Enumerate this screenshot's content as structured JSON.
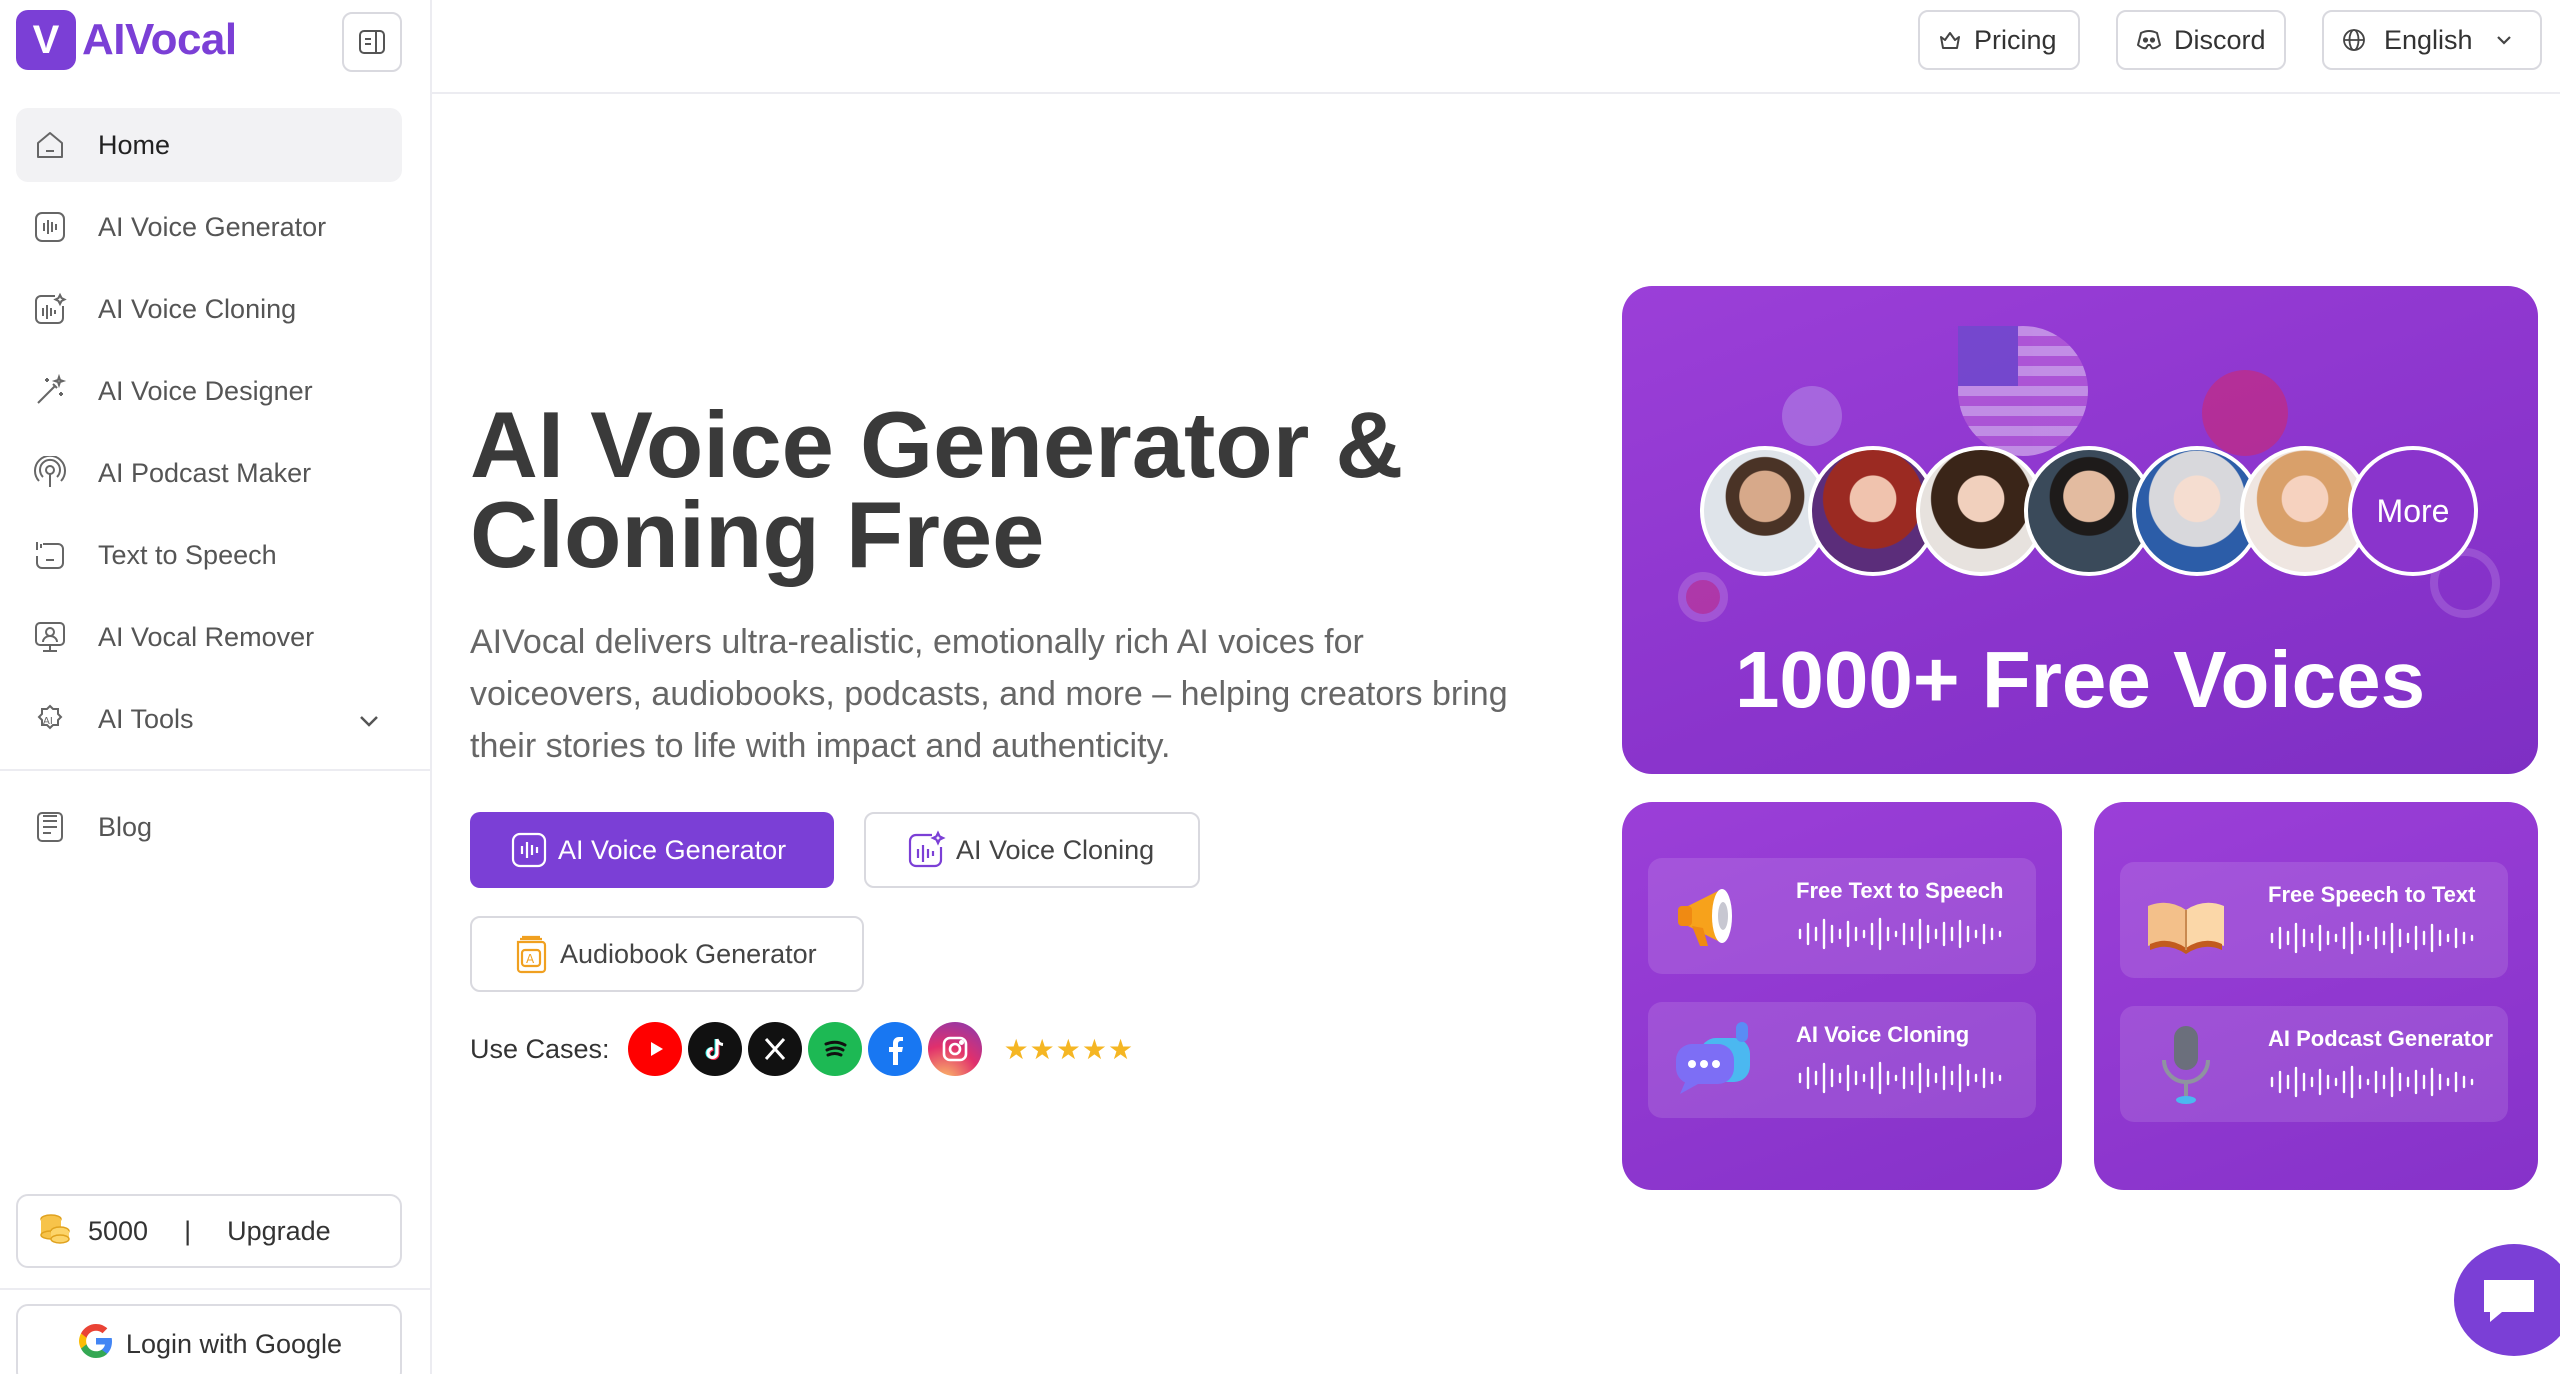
{
  "brand": {
    "mark": "V",
    "name": "AIVocal",
    "accent": "#7b3fd6"
  },
  "nav": {
    "items": [
      {
        "label": "Home",
        "icon": "home-icon",
        "active": true
      },
      {
        "label": "AI Voice Generator",
        "icon": "waveform-icon"
      },
      {
        "label": "AI Voice Cloning",
        "icon": "voice-clone-icon"
      },
      {
        "label": "AI Voice Designer",
        "icon": "magic-wand-icon"
      },
      {
        "label": "AI Podcast Maker",
        "icon": "podcast-icon"
      },
      {
        "label": "Text to Speech",
        "icon": "text-speech-icon"
      },
      {
        "label": "AI Vocal Remover",
        "icon": "vocal-remover-icon"
      },
      {
        "label": "AI Tools",
        "icon": "ai-tools-icon"
      }
    ],
    "blog": "Blog"
  },
  "credits": {
    "amount": "5000",
    "separator": "|",
    "upgrade": "Upgrade"
  },
  "login": {
    "label": "Login with Google"
  },
  "topbar": {
    "pricing": "Pricing",
    "discord": "Discord",
    "language": "English"
  },
  "hero": {
    "title_line1": "AI Voice Generator &",
    "title_line2": "Cloning Free",
    "desc_line1": "AIVocal delivers ultra-realistic, emotionally rich AI voices for",
    "desc_line2": "voiceovers, audiobooks, podcasts, and more – helping creators bring",
    "desc_line3": "their stories to life with impact and authenticity.",
    "btn_generator": "AI Voice Generator",
    "btn_cloning": "AI Voice Cloning",
    "btn_audiobook": "Audiobook Generator",
    "use_cases_label": "Use Cases:",
    "stars": "★★★★★",
    "socials": [
      "youtube-icon",
      "tiktok-icon",
      "x-icon",
      "spotify-icon",
      "facebook-icon",
      "instagram-icon"
    ]
  },
  "panel": {
    "more": "More",
    "headline": "1000+ Free Voices",
    "features": {
      "tts": "Free Text to Speech",
      "cloning": "AI Voice Cloning",
      "stt": "Free Speech to Text",
      "podcast": "AI Podcast Generator"
    }
  }
}
